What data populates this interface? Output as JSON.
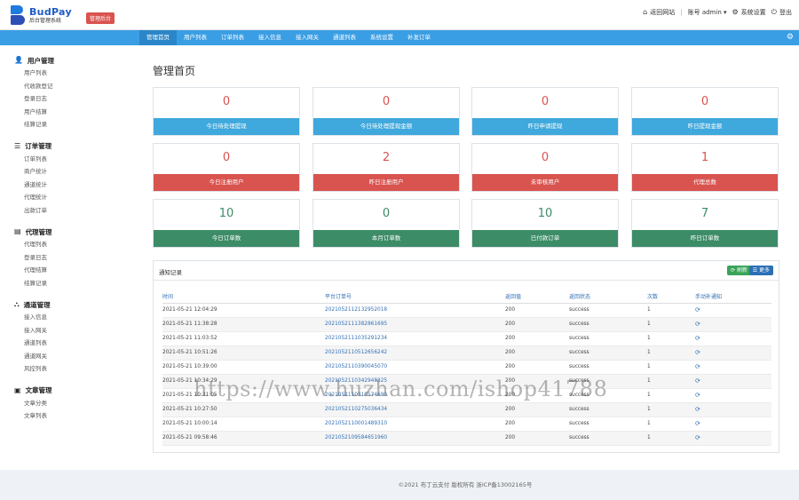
{
  "header": {
    "logo_name": "BudPay",
    "logo_sub": "后台管理系统",
    "badge": "管理后台",
    "links": [
      {
        "icon": "home-icon",
        "label": "返回网站"
      },
      {
        "icon": "user-icon",
        "label": "账号 admin ▾"
      },
      {
        "icon": "gear-icon",
        "label": "系统设置"
      },
      {
        "icon": "power-icon",
        "label": "登出"
      }
    ]
  },
  "nav": {
    "items": [
      "管理首页",
      "用户列表",
      "订单列表",
      "接入信息",
      "接入网关",
      "通道列表",
      "系统设置",
      "补发订单"
    ]
  },
  "sidebar": {
    "groups": [
      {
        "title": "用户管理",
        "icon": "user-icon",
        "items": [
          "用户列表",
          "代收款登记",
          "登录日志",
          "用户结算",
          "结算记录"
        ]
      },
      {
        "title": "订单管理",
        "icon": "list-icon",
        "items": [
          "订单列表",
          "商户统计",
          "通道统计",
          "代理统计",
          "出款订单"
        ]
      },
      {
        "title": "代理管理",
        "icon": "document-icon",
        "items": [
          "代理列表",
          "登录日志",
          "代理结算",
          "结算记录"
        ]
      },
      {
        "title": "通道管理",
        "icon": "channel-icon",
        "items": [
          "接入信息",
          "接入网关",
          "通道列表",
          "通道网关",
          "风控列表"
        ]
      },
      {
        "title": "文章管理",
        "icon": "article-icon",
        "items": [
          "文章分类",
          "文章列表"
        ]
      }
    ]
  },
  "main": {
    "title": "管理首页",
    "stats": [
      {
        "value": "0",
        "label": "今日待处理提现",
        "color": "blue"
      },
      {
        "value": "0",
        "label": "今日待处理提现金额",
        "color": "blue"
      },
      {
        "value": "0",
        "label": "昨日申请提现",
        "color": "blue"
      },
      {
        "value": "0",
        "label": "昨日提现金额",
        "color": "blue"
      },
      {
        "value": "0",
        "label": "今日注册用户",
        "color": "red"
      },
      {
        "value": "2",
        "label": "昨日注册用户",
        "color": "red"
      },
      {
        "value": "0",
        "label": "未审核用户",
        "color": "red"
      },
      {
        "value": "1",
        "label": "代理总数",
        "color": "red"
      },
      {
        "value": "10",
        "label": "今日订单数",
        "color": "green"
      },
      {
        "value": "0",
        "label": "本月订单数",
        "color": "green"
      },
      {
        "value": "10",
        "label": "已付款订单",
        "color": "green"
      },
      {
        "value": "7",
        "label": "昨日订单数",
        "color": "green"
      }
    ]
  },
  "log_panel": {
    "title": "通知记录",
    "refresh_label": "刷新",
    "more_label": "更多",
    "columns": [
      "时间",
      "平台订单号",
      "返回值",
      "返回状态",
      "次数",
      "手动补通知"
    ],
    "rows": [
      [
        "2021-05-21 12:04:29",
        "2021052112132952018",
        "200",
        "success",
        "1"
      ],
      [
        "2021-05-21 11:38:28",
        "2021052111382861695",
        "200",
        "success",
        "1"
      ],
      [
        "2021-05-21 11:03:52",
        "2021052111035291234",
        "200",
        "success",
        "1"
      ],
      [
        "2021-05-21 10:51:26",
        "2021052110512656242",
        "200",
        "success",
        "1"
      ],
      [
        "2021-05-21 10:39:00",
        "2021052110390045070",
        "200",
        "success",
        "1"
      ],
      [
        "2021-05-21 10:34:29",
        "2021052110342948325",
        "200",
        "success",
        "1"
      ],
      [
        "2021-05-21 10:31:05",
        "2021052110310574690",
        "200",
        "success",
        "1"
      ],
      [
        "2021-05-21 10:27:50",
        "2021052110275036434",
        "200",
        "success",
        "1"
      ],
      [
        "2021-05-21 10:00:14",
        "2021052110001489310",
        "200",
        "success",
        "1"
      ],
      [
        "2021-05-21 09:58:46",
        "2021052109584651960",
        "200",
        "success",
        "1"
      ]
    ]
  },
  "footer": "©2021 布丁云支付 版权所有 浙ICP备13002165号",
  "watermark": "https://www.huzhan.com/ishop41788",
  "colors": {
    "nav_blue": "#3a9ee4",
    "stat_blue": "#3fa8dc",
    "stat_red": "#d9534f",
    "stat_green": "#3d8c68"
  }
}
